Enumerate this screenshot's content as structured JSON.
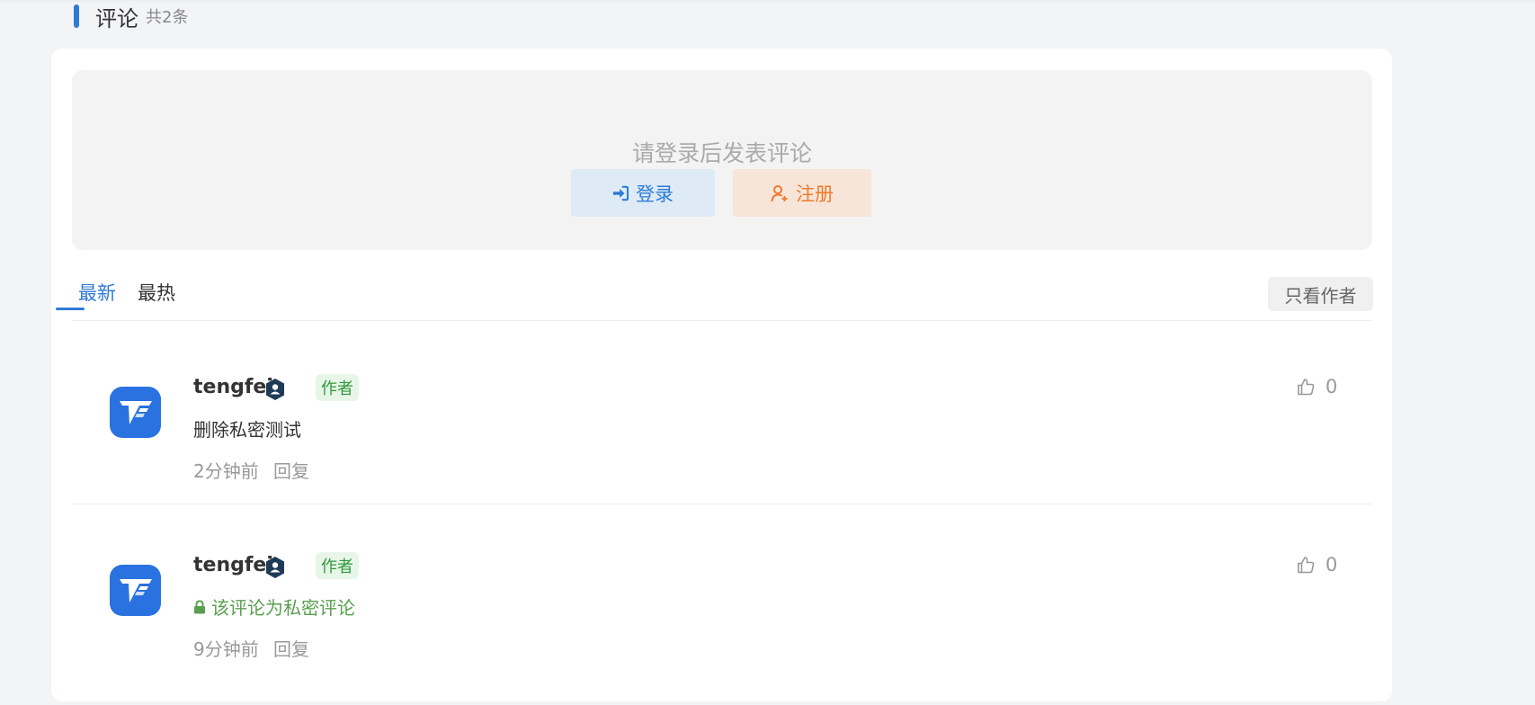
{
  "section": {
    "title": "评论",
    "count": "共2条"
  },
  "login_box": {
    "prompt": "请登录后发表评论",
    "login_label": "登录",
    "register_label": "注册"
  },
  "tabs": [
    {
      "label": "最新",
      "active": true
    },
    {
      "label": "最热",
      "active": false
    }
  ],
  "filter": {
    "author_only_label": "只看作者"
  },
  "comments": [
    {
      "username": "tengfei",
      "tag": "作者",
      "text": "删除私密测试",
      "time": "2分钟前",
      "reply_label": "回复",
      "likes": "0"
    },
    {
      "username": "tengfei",
      "tag": "作者",
      "private_text": "该评论为私密评论",
      "time": "9分钟前",
      "reply_label": "回复",
      "likes": "0"
    }
  ],
  "colors": {
    "accent": "#2e7bd6",
    "register": "#ee7b2a",
    "author_tag": "#2f9a3c",
    "private_text": "#5a9e4f",
    "avatar": "#2a72e0"
  },
  "icons": {
    "login": "sign-in-icon",
    "register": "user-plus-icon",
    "verified": "verified-user-icon",
    "lock": "lock-icon",
    "like": "thumbs-up-icon"
  }
}
